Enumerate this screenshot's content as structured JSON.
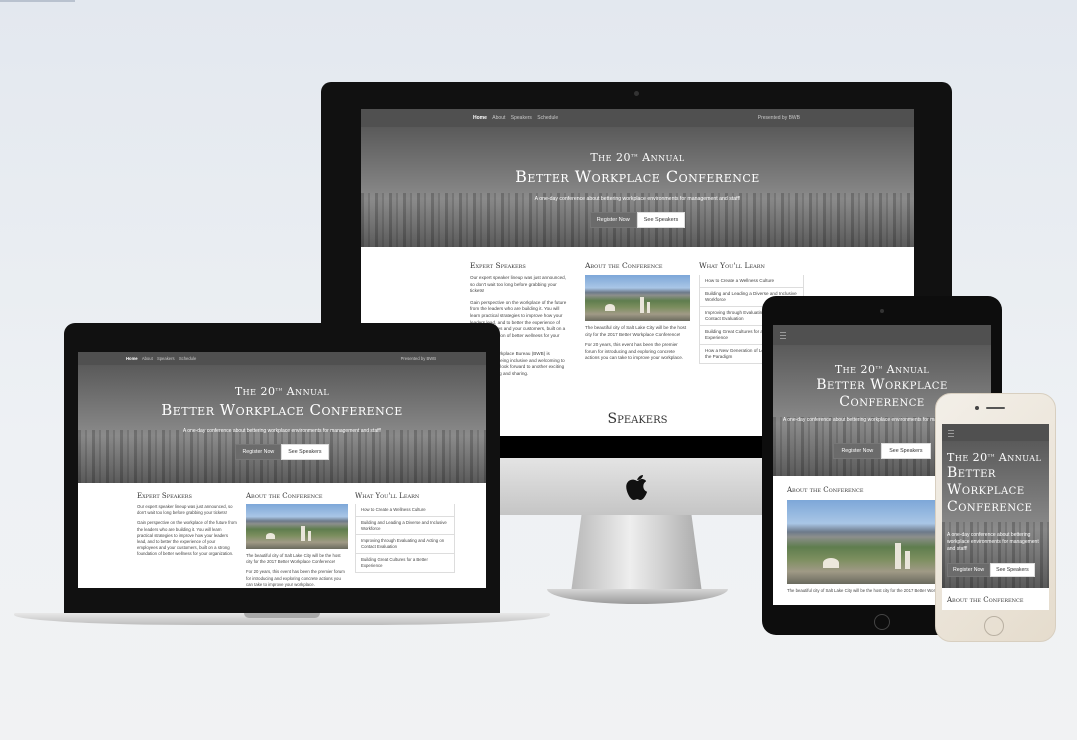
{
  "site": {
    "nav": {
      "home": "Home",
      "about": "About",
      "speakers": "Speakers",
      "schedule": "Schedule",
      "presented_by": "Presented by BWB"
    },
    "hero": {
      "title_small": "The 20th Annual",
      "title_sup": "th",
      "title_pre": "The 20",
      "title_post": " Annual",
      "title_big": "Better Workplace Conference",
      "title_big_line1": "Better",
      "title_big_line2": "Workplace",
      "title_big_line3": "Conference",
      "tagline": "A one-day conference about bettering workplace environments for management and staff!",
      "register": "Register Now",
      "see_speakers": "See Speakers"
    },
    "speakers": {
      "heading": "Expert Speakers",
      "p1": "Our expert speaker lineup was just announced, so don't wait too long before grabbing your tickets!",
      "p2": "Gain perspective on the workplace of the future from the leaders who are building it. You will learn practical strategies to improve how your leaders lead, and to better the experience of your employees and your customers, built on a strong foundation of better wellness for your organization.",
      "p3": "The Better Workplace Bureau (BWB) is committed to being inclusive and welcoming to all people. We look forward to another exciting year of learning and sharing."
    },
    "about": {
      "heading": "About the Conference",
      "p1": "The beautiful city of Salt Lake City will be the host city for the 2017 Better Workplace Conference!",
      "p2": "For 20 years, this event has been the premier forum for introducing and exploring concrete actions you can take to improve your workplace."
    },
    "learn": {
      "heading": "What You'll Learn",
      "items": [
        "How to Create a Wellness Culture",
        "Building and Leading a Diverse and Inclusive Workforce",
        "Improving through Evaluating and Acting on Contact Evaluation",
        "Building Great Cultures for a Better Experience",
        "How a New Generation of Leaders Redefines the Paradigm"
      ]
    },
    "speakers_section": "Speakers"
  },
  "colors": {
    "background": "#e6ebf1",
    "nav": "#505050",
    "device_black": "#121212",
    "silver": "#c9c9c9"
  }
}
